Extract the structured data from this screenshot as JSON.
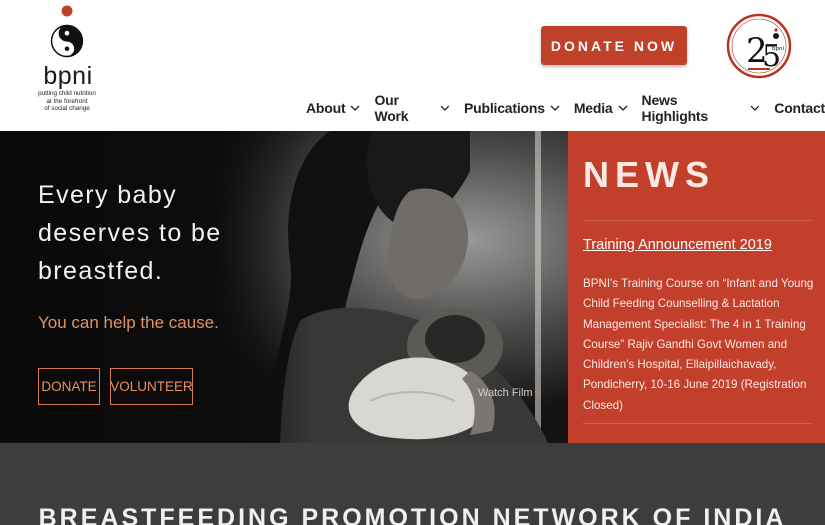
{
  "brand": {
    "name": "bpni",
    "tagline_lines": [
      "putting child nutrition",
      "at the forefront",
      "of social change"
    ]
  },
  "header": {
    "donate_label": "DONATE NOW",
    "badge_text": "25 years"
  },
  "nav": {
    "items": [
      {
        "label": "About",
        "has_dropdown": true
      },
      {
        "label": "Our Work",
        "has_dropdown": true
      },
      {
        "label": "Publications",
        "has_dropdown": true
      },
      {
        "label": "Media",
        "has_dropdown": true
      },
      {
        "label": "News Highlights",
        "has_dropdown": true
      },
      {
        "label": "Contact",
        "has_dropdown": false
      }
    ]
  },
  "hero": {
    "title_lines": [
      "Every baby",
      "deserves to be",
      "breastfed."
    ],
    "subtitle": "You can help the cause.",
    "donate_label": "DONATE",
    "volunteer_label": "VOLUNTEER",
    "watch_film_label": "Watch Film",
    "watch_film_icon": "chevron-right-icon"
  },
  "news": {
    "heading": "NEWS",
    "item_title": "Training Announcement 2019",
    "item_body": "BPNI's Training Course on “Infant and Young Child Feeding Counselling & Lactation Management Specialist: The 4 in 1 Training Course” Rajiv Gandhi Govt Women and Children's Hospital, Ellaipillaichavady, Pondicherry, 10-16 June 2019 (Registration Closed)"
  },
  "band": {
    "title": "BREASTFEEDING PROMOTION NETWORK OF INDIA"
  },
  "colors": {
    "accent": "#c0412a",
    "news_bg": "#c2402b",
    "hero_accent_text": "#e39361",
    "band_bg": "#3d3d3d"
  }
}
